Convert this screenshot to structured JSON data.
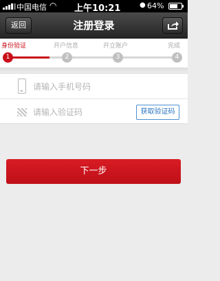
{
  "status_bar": {
    "carrier": "中国电信",
    "time": "上午10:21",
    "battery": "64%",
    "battery_level": 0.64,
    "icons": [
      "signal-icon",
      "wifi-icon",
      "lock-icon",
      "battery-icon"
    ]
  },
  "nav": {
    "back_label": "返回",
    "title": "注册登录",
    "share_icon": "share-icon"
  },
  "steps": {
    "items": [
      {
        "label": "身份验证",
        "number": "1"
      },
      {
        "label": "开户信息",
        "number": "2"
      },
      {
        "label": "开立账户",
        "number": "3"
      },
      {
        "label": "完成",
        "number": "4"
      }
    ],
    "active_index": 0
  },
  "form": {
    "phone_placeholder": "请输入手机号码",
    "code_placeholder": "请输入验证码",
    "get_code_label": "获取验证码"
  },
  "next_label": "下一步",
  "colors": {
    "accent": "#c8101a",
    "link": "#2a75c0",
    "nav_bg": "#333333",
    "page_bg": "#ececec"
  }
}
